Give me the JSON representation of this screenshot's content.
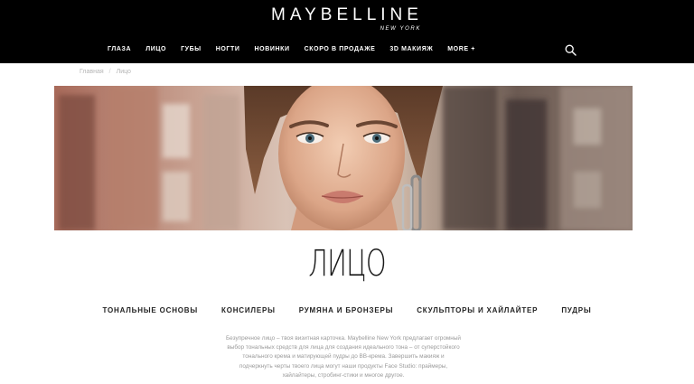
{
  "header": {
    "logo": "MAYBELLINE",
    "logo_sub": "NEW YORK",
    "nav": [
      "ГЛАЗА",
      "ЛИЦО",
      "ГУБЫ",
      "НОГТИ",
      "НОВИНКИ",
      "СКОРО В ПРОДАЖЕ",
      "3D МАКИЯЖ",
      "MORE +"
    ],
    "search_icon": "search-icon"
  },
  "breadcrumb": {
    "home": "Главная",
    "separator": "/",
    "current": "Лицо"
  },
  "page": {
    "title": "ЛИЦО",
    "categories": [
      "ТОНАЛЬНЫЕ ОСНОВЫ",
      "КОНСИЛЕРЫ",
      "РУМЯНА И БРОНЗЕРЫ",
      "СКУЛЬПТОРЫ И ХАЙЛАЙТЕР",
      "ПУДРЫ"
    ],
    "description_lines": [
      "Безупречное лицо – твоя визитная карточка. Maybelline New York предлагает огромный",
      "выбор тональных средств для лица для создания идеального тона – от суперстойкого",
      "тонального крема и матирующей пудры до BB-крема. Завершить макияж и",
      "подчеркнуть черты твоего лица могут наши продукты Face Studio: праймеры,",
      "хайлайтеры, стробинг-стики и многое другое."
    ]
  },
  "colors": {
    "header_bg": "#000000",
    "header_text": "#ffffff",
    "title": "#1a1a1a",
    "muted": "#9a9a9a"
  }
}
